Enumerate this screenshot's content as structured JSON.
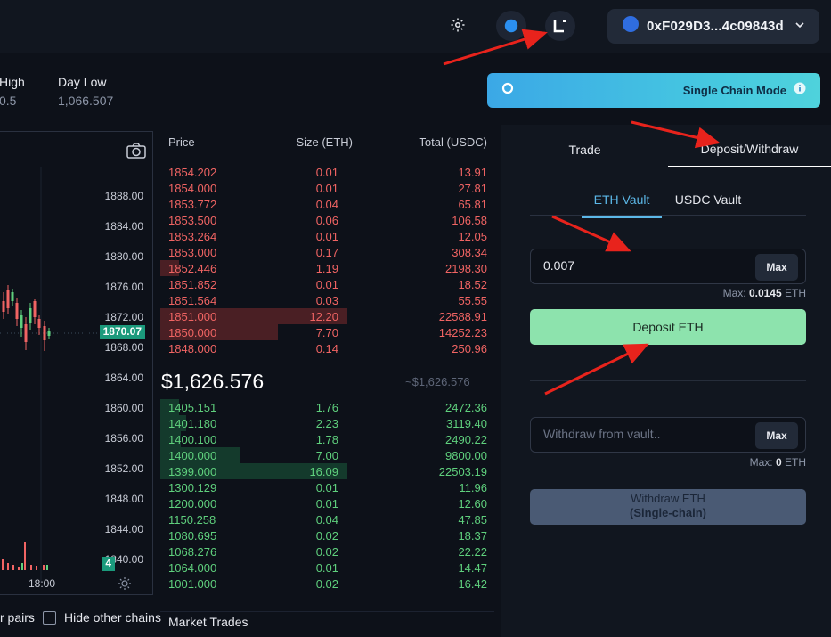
{
  "topbar": {
    "wallet_address": "0xF029D3...4c09843d"
  },
  "stats": {
    "high_label": "High",
    "high_value": "0.5",
    "low_label": "Day Low",
    "low_value": "1,066.507"
  },
  "chart": {
    "y_labels": [
      "1888.00",
      "1884.00",
      "1880.00",
      "1876.00",
      "1872.00",
      "1868.00",
      "1864.00",
      "1860.00",
      "1856.00",
      "1852.00",
      "1848.00",
      "1844.00",
      "1840.00"
    ],
    "current_price_badge": "1870.07",
    "volume_badge": "4",
    "time_label": "18:00"
  },
  "bottom": {
    "pairs_label": "r pairs",
    "hide_chains_label": "Hide other chains"
  },
  "orderbook": {
    "headers": {
      "price": "Price",
      "size": "Size (ETH)",
      "total": "Total (USDC)"
    },
    "asks": [
      {
        "price": "1854.202",
        "size": "0.01",
        "total": "13.91"
      },
      {
        "price": "1854.000",
        "size": "0.01",
        "total": "27.81"
      },
      {
        "price": "1853.772",
        "size": "0.04",
        "total": "65.81"
      },
      {
        "price": "1853.500",
        "size": "0.06",
        "total": "106.58"
      },
      {
        "price": "1853.264",
        "size": "0.01",
        "total": "12.05"
      },
      {
        "price": "1853.000",
        "size": "0.17",
        "total": "308.34"
      },
      {
        "price": "1852.446",
        "size": "1.19",
        "total": "2198.30"
      },
      {
        "price": "1851.852",
        "size": "0.01",
        "total": "18.52"
      },
      {
        "price": "1851.564",
        "size": "0.03",
        "total": "55.55"
      },
      {
        "price": "1851.000",
        "size": "12.20",
        "total": "22588.91"
      },
      {
        "price": "1850.000",
        "size": "7.70",
        "total": "14252.23"
      },
      {
        "price": "1848.000",
        "size": "0.14",
        "total": "250.96"
      }
    ],
    "ask_depth": [
      0,
      0,
      0,
      0,
      0,
      0,
      0.1,
      0,
      0,
      1.0,
      0.63,
      0
    ],
    "mid_price": "$1,626.576",
    "mid_price_secondary": "~$1,626.576",
    "bids": [
      {
        "price": "1405.151",
        "size": "1.76",
        "total": "2472.36"
      },
      {
        "price": "1401.180",
        "size": "2.23",
        "total": "3119.40"
      },
      {
        "price": "1400.100",
        "size": "1.78",
        "total": "2490.22"
      },
      {
        "price": "1400.000",
        "size": "7.00",
        "total": "9800.00"
      },
      {
        "price": "1399.000",
        "size": "16.09",
        "total": "22503.19"
      },
      {
        "price": "1300.129",
        "size": "0.01",
        "total": "11.96"
      },
      {
        "price": "1200.000",
        "size": "0.01",
        "total": "12.60"
      },
      {
        "price": "1150.258",
        "size": "0.04",
        "total": "47.85"
      },
      {
        "price": "1080.695",
        "size": "0.02",
        "total": "18.37"
      },
      {
        "price": "1068.276",
        "size": "0.02",
        "total": "22.22"
      },
      {
        "price": "1064.000",
        "size": "0.01",
        "total": "14.47"
      },
      {
        "price": "1001.000",
        "size": "0.02",
        "total": "16.42"
      }
    ],
    "bid_depth": [
      0.1,
      0.14,
      0.11,
      0.43,
      1.0,
      0,
      0,
      0,
      0,
      0,
      0,
      0
    ],
    "market_trades_label": "Market Trades"
  },
  "panel": {
    "mode_label": "Single Chain Mode",
    "tabs": [
      "Trade",
      "Deposit/Withdraw"
    ],
    "subtabs": [
      "ETH Vault",
      "USDC Vault"
    ],
    "deposit_input_value": "0.007",
    "max_label": "Max",
    "deposit_max_prefix": "Max: ",
    "deposit_max_value": "0.0145",
    "deposit_max_unit": " ETH",
    "deposit_button": "Deposit ETH",
    "withdraw_placeholder": "Withdraw from vault..",
    "withdraw_max_value": "0",
    "withdraw_button_line1": "Withdraw ETH",
    "withdraw_button_line2": "(Single-chain)"
  },
  "colors": {
    "ask": "#f06463",
    "bid": "#5fd07d",
    "accent": "#46c9e0",
    "deposit_button": "#8de3ad"
  }
}
